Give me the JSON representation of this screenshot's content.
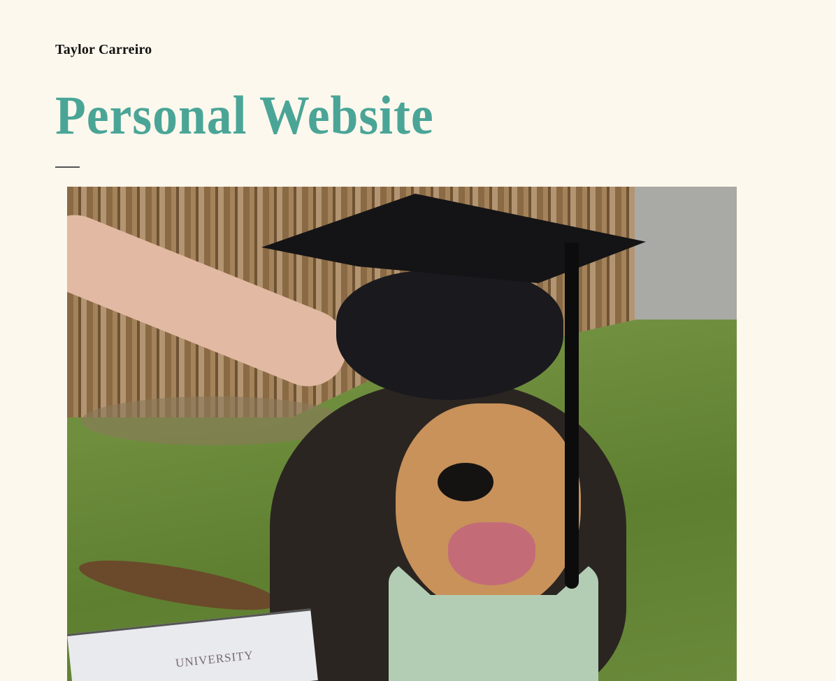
{
  "header": {
    "author": "Taylor Carreiro",
    "title": "Personal Website"
  },
  "hero_image": {
    "diploma_text": "UNIVERSITY"
  },
  "colors": {
    "background": "#fdf8ed",
    "accent": "#4aa597"
  }
}
